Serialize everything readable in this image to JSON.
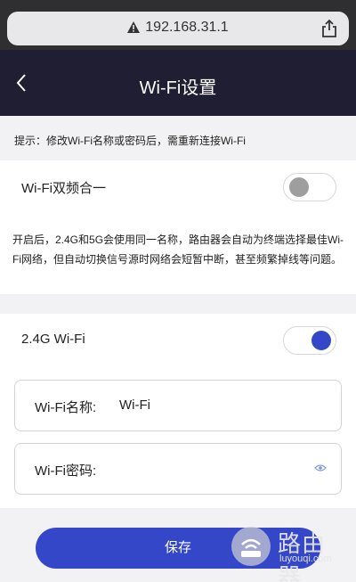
{
  "browser": {
    "url": "192.168.31.1"
  },
  "header": {
    "title": "Wi-Fi设置"
  },
  "tip": "提示：修改Wi-Fi名称或密码后，需重新连接Wi-Fi",
  "dual_band": {
    "label": "Wi-Fi双频合一",
    "enabled": false
  },
  "description": "开启后，2.4G和5G会使用同一名称，路由器会自动为终端选择最佳Wi-Fi网络，但自动切换信号源时网络会短暂中断，甚至频繁掉线等问题。",
  "wifi_24g": {
    "label": "2.4G Wi-Fi",
    "enabled": true
  },
  "form": {
    "name_label": "Wi-Fi名称:",
    "name_value": "Wi-Fi",
    "password_label": "Wi-Fi密码:",
    "password_value": ""
  },
  "save_label": "保存",
  "watermark": {
    "main": "路由器",
    "sub": "luyouqi.com"
  },
  "colors": {
    "accent": "#3347c8",
    "header_bg": "#1f1e32",
    "toggle_off_knob": "#9e9e9e"
  },
  "icons": [
    "warning-icon",
    "share-icon",
    "back-icon",
    "eye-icon",
    "router-logo-icon"
  ]
}
